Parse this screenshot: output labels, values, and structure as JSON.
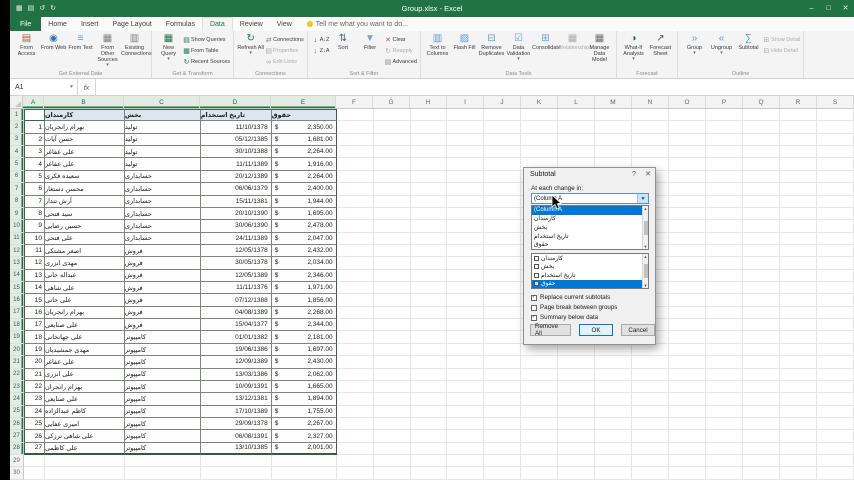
{
  "titlebar": {
    "title": "Group.xlsx - Excel",
    "quick_access": [
      "excel-logo",
      "save",
      "undo",
      "redo"
    ],
    "window_controls": [
      "–",
      "□",
      "✕"
    ]
  },
  "ribbon_tabs": {
    "tabs": [
      {
        "label": "File",
        "file": true
      },
      {
        "label": "Home"
      },
      {
        "label": "Insert"
      },
      {
        "label": "Page Layout"
      },
      {
        "label": "Formulas"
      },
      {
        "label": "Data"
      },
      {
        "label": "Review"
      },
      {
        "label": "View"
      }
    ],
    "active": "Data",
    "tell_me": "Tell me what you want to do..."
  },
  "ribbon": {
    "groups": [
      {
        "label": "Get External Data",
        "blocks": [
          {
            "type": "big",
            "label": "From Access",
            "icon": "access"
          },
          {
            "type": "big",
            "label": "From Web",
            "icon": "web"
          },
          {
            "type": "big",
            "label": "From Text",
            "icon": "text"
          },
          {
            "type": "big",
            "label": "From Other Sources",
            "icon": "other",
            "caret": true
          },
          {
            "type": "big",
            "label": "Existing Connections",
            "icon": "existing"
          }
        ]
      },
      {
        "label": "Get & Transform",
        "blocks": [
          {
            "type": "big",
            "label": "New Query",
            "icon": "newquery",
            "caret": true
          },
          {
            "type": "col",
            "items": [
              {
                "label": "Show Queries",
                "icon": "showq"
              },
              {
                "label": "From Table",
                "icon": "fromtable"
              },
              {
                "label": "Recent Sources",
                "icon": "recent"
              }
            ]
          }
        ]
      },
      {
        "label": "Connections",
        "blocks": [
          {
            "type": "big",
            "label": "Refresh All",
            "icon": "refresh",
            "caret": true
          },
          {
            "type": "col",
            "items": [
              {
                "label": "Connections",
                "icon": "connections"
              },
              {
                "label": "Properties",
                "icon": "properties",
                "disabled": true
              },
              {
                "label": "Edit Links",
                "icon": "editlinks",
                "disabled": true
              }
            ]
          }
        ]
      },
      {
        "label": "Sort & Filter",
        "blocks": [
          {
            "type": "col",
            "items": [
              {
                "label": "A↓Z",
                "icon": "az"
              },
              {
                "label": "Z↓A",
                "icon": "za"
              }
            ]
          },
          {
            "type": "big",
            "label": "Sort",
            "icon": "sort"
          },
          {
            "type": "big",
            "label": "Filter",
            "icon": "filter"
          },
          {
            "type": "col",
            "items": [
              {
                "label": "Clear",
                "icon": "clear"
              },
              {
                "label": "Reapply",
                "icon": "reapply",
                "disabled": true
              },
              {
                "label": "Advanced",
                "icon": "advanced"
              }
            ]
          }
        ]
      },
      {
        "label": "Data Tools",
        "blocks": [
          {
            "type": "big",
            "label": "Text to Columns",
            "icon": "ttc"
          },
          {
            "type": "big",
            "label": "Flash Fill",
            "icon": "flash"
          },
          {
            "type": "big",
            "label": "Remove Duplicates",
            "icon": "dup"
          },
          {
            "type": "big",
            "label": "Data Validation",
            "icon": "validation",
            "caret": true
          },
          {
            "type": "big",
            "label": "Consolidate",
            "icon": "consolidate"
          },
          {
            "type": "big",
            "label": "Relationships",
            "icon": "relationships",
            "disabled": true
          },
          {
            "type": "big",
            "label": "Manage Data Model",
            "icon": "datamodel"
          }
        ]
      },
      {
        "label": "Forecast",
        "blocks": [
          {
            "type": "big",
            "label": "What-If Analysis",
            "icon": "whatif",
            "caret": true
          },
          {
            "type": "big",
            "label": "Forecast Sheet",
            "icon": "fsheet"
          }
        ]
      },
      {
        "label": "Outline",
        "blocks": [
          {
            "type": "big",
            "label": "Group",
            "icon": "group",
            "caret": true
          },
          {
            "type": "big",
            "label": "Ungroup",
            "icon": "ungroup",
            "caret": true
          },
          {
            "type": "big",
            "label": "Subtotal",
            "icon": "subtotal"
          },
          {
            "type": "col",
            "items": [
              {
                "label": "Show Detail",
                "icon": "showdetail",
                "disabled": true
              },
              {
                "label": "Hide Detail",
                "icon": "hidedetail",
                "disabled": true
              }
            ]
          }
        ]
      }
    ]
  },
  "formula_bar": {
    "name_box": "A1",
    "formula": ""
  },
  "sheet": {
    "columns": [
      "A",
      "B",
      "C",
      "D",
      "E",
      "F",
      "G",
      "H",
      "I",
      "J",
      "K",
      "L",
      "M",
      "N",
      "O",
      "P",
      "Q",
      "R",
      "S"
    ],
    "row_count": 30,
    "active_cell": "A1",
    "table": {
      "headers": [
        "کارمندان",
        "بخش",
        "تاریخ استخدام",
        "حقوق"
      ],
      "currency": "$",
      "rows": [
        {
          "n": 1,
          "name": "بهرام رانجریان",
          "dept": "تولید",
          "date": "11/10/1378",
          "salary": "2,350.00"
        },
        {
          "n": 2,
          "name": "حسن آیات",
          "dept": "تولید",
          "date": "05/12/1385",
          "salary": "1,681.00"
        },
        {
          "n": 3,
          "name": "علی عفاغر",
          "dept": "تولید",
          "date": "30/10/1388",
          "salary": "2,264.00"
        },
        {
          "n": 4,
          "name": "علی عفاغر",
          "dept": "تولید",
          "date": "11/11/1389",
          "salary": "1,916.00"
        },
        {
          "n": 5,
          "name": "سعیده فکری",
          "dept": "حسابداری",
          "date": "20/12/1389",
          "salary": "2,264.00"
        },
        {
          "n": 6,
          "name": "محسن دستغار",
          "dept": "حسابداری",
          "date": "06/06/1379",
          "salary": "2,400.00"
        },
        {
          "n": 7,
          "name": "آرش تندار",
          "dept": "حسابداری",
          "date": "15/11/1381",
          "salary": "1,944.00"
        },
        {
          "n": 8,
          "name": "سید فتحی",
          "dept": "حسابداری",
          "date": "20/10/1390",
          "salary": "1,695.00"
        },
        {
          "n": 9,
          "name": "حسین رضایی",
          "dept": "حسابداری",
          "date": "30/06/1390",
          "salary": "2,478.00"
        },
        {
          "n": 10,
          "name": "علی فتحی",
          "dept": "حسابداری",
          "date": "24/11/1389",
          "salary": "2,047.00"
        },
        {
          "n": 11,
          "name": "اصغر مشتکی",
          "dept": "فروش",
          "date": "12/05/1378",
          "salary": "2,432.00"
        },
        {
          "n": 12,
          "name": "مهدی انزری",
          "dept": "فروش",
          "date": "30/05/1378",
          "salary": "2,034.00"
        },
        {
          "n": 13,
          "name": "عبداله خانی",
          "dept": "فروش",
          "date": "12/05/1389",
          "salary": "2,346.00"
        },
        {
          "n": 14,
          "name": "علی شاهی",
          "dept": "فروش",
          "date": "11/11/1376",
          "salary": "1,971.00"
        },
        {
          "n": 15,
          "name": "علی خانی",
          "dept": "فروش",
          "date": "07/12/1388",
          "salary": "1,856.00"
        },
        {
          "n": 16,
          "name": "بهرام رانجریان",
          "dept": "فروش",
          "date": "04/08/1389",
          "salary": "2,268.00"
        },
        {
          "n": 17,
          "name": "علی صنایعی",
          "dept": "فروش",
          "date": "15/04/1377",
          "salary": "2,344.00"
        },
        {
          "n": 18,
          "name": "علی جهانخانی",
          "dept": "کامپیوتر",
          "date": "01/01/1382",
          "salary": "2,181.00"
        },
        {
          "n": 19,
          "name": "مهدی جمشیدیان",
          "dept": "کامپیوتر",
          "date": "19/06/1386",
          "salary": "1,697.00"
        },
        {
          "n": 20,
          "name": "علی عفاغر",
          "dept": "کامپیوتر",
          "date": "12/09/1389",
          "salary": "2,430.00"
        },
        {
          "n": 21,
          "name": "علی انزری",
          "dept": "کامپیوتر",
          "date": "13/03/1386",
          "salary": "2,062.00"
        },
        {
          "n": 22,
          "name": "بهرام رانجران",
          "dept": "کامپیوتر",
          "date": "10/09/1391",
          "salary": "1,665.00"
        },
        {
          "n": 23,
          "name": "علی صنایعی",
          "dept": "کامپیوتر",
          "date": "13/12/1381",
          "salary": "1,894.00"
        },
        {
          "n": 24,
          "name": "کاظم عبدالزاده",
          "dept": "کامپیوتر",
          "date": "17/10/1389",
          "salary": "1,755.00"
        },
        {
          "n": 25,
          "name": "امیری عفایی",
          "dept": "کامپیوتر",
          "date": "29/09/1378",
          "salary": "2,267.00"
        },
        {
          "n": 26,
          "name": "علی شاهی نرزکی",
          "dept": "کامپیوتر",
          "date": "06/08/1391",
          "salary": "2,327.00"
        },
        {
          "n": 27,
          "name": "علی کاظمی",
          "dept": "کامپیوتر",
          "date": "13/10/1385",
          "salary": "2,001.00"
        }
      ]
    }
  },
  "dialog": {
    "title": "Subtotal",
    "help_label": "?",
    "close_label": "✕",
    "at_each_change_label": "At each change in:",
    "combo_value": "(Column A",
    "dropdown_options": [
      {
        "label": "(Column A",
        "highlighted": true
      },
      {
        "label": "کارمندان"
      },
      {
        "label": "بخش"
      },
      {
        "label": "تاریخ استخدام"
      },
      {
        "label": "حقوق"
      }
    ],
    "subtotal_list": [
      {
        "label": "کارمندان",
        "checked": false
      },
      {
        "label": "بخش",
        "checked": false
      },
      {
        "label": "تاریخ استخدام",
        "checked": false
      },
      {
        "label": "حقوق",
        "checked": true,
        "highlighted": true
      }
    ],
    "options": [
      {
        "label": "Replace current subtotals",
        "checked": true
      },
      {
        "label": "Page break between groups",
        "checked": false
      },
      {
        "label": "Summary below data",
        "checked": true
      }
    ],
    "buttons": [
      {
        "label": "Remove All"
      },
      {
        "label": "OK",
        "default": true
      },
      {
        "label": "Cancel"
      }
    ]
  }
}
